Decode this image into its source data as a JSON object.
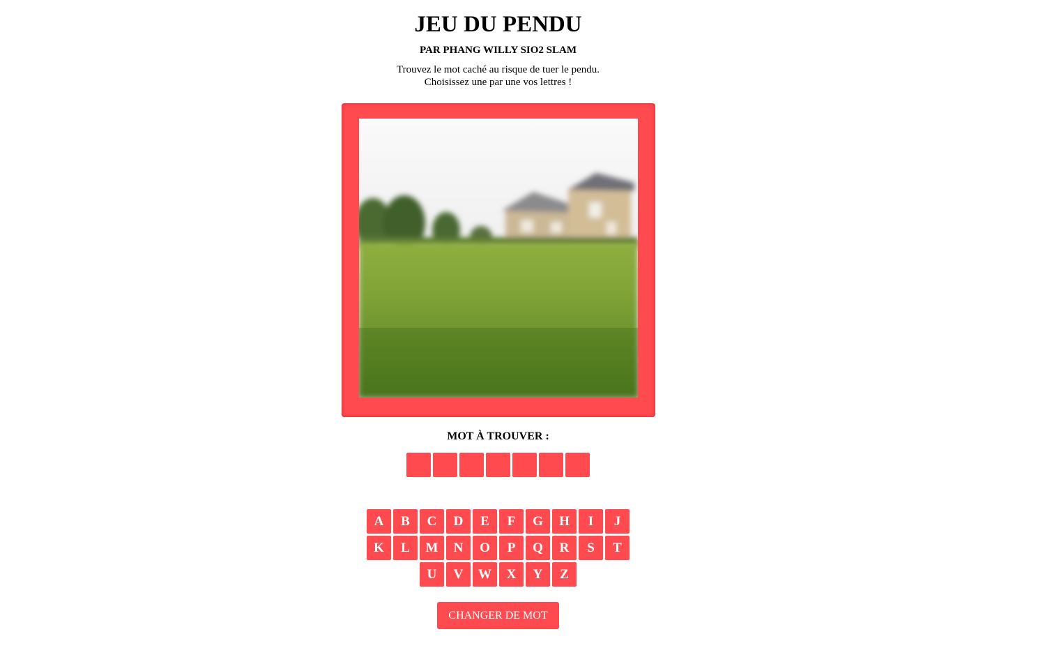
{
  "header": {
    "title": "JEU DU PENDU",
    "subtitle": "PAR PHANG WILLY SIO2 SLAM",
    "intro_line1": "Trouvez le mot caché au risque de tuer le pendu.",
    "intro_line2": "Choisissez une par une vos lettres !"
  },
  "game": {
    "word_label": "MOT À TROUVER :",
    "word_slots": [
      "",
      "",
      "",
      "",
      "",
      "",
      ""
    ]
  },
  "keyboard": {
    "rows": [
      [
        "A",
        "B",
        "C",
        "D",
        "E",
        "F",
        "G",
        "H",
        "I",
        "J"
      ],
      [
        "K",
        "L",
        "M",
        "N",
        "O",
        "P",
        "Q",
        "R",
        "S",
        "T"
      ],
      [
        "U",
        "V",
        "W",
        "X",
        "Y",
        "Z"
      ]
    ]
  },
  "actions": {
    "change_word_label": "CHANGER DE MOT"
  },
  "colors": {
    "accent": "#ff4a4f",
    "accent_text": "#ffffff"
  }
}
